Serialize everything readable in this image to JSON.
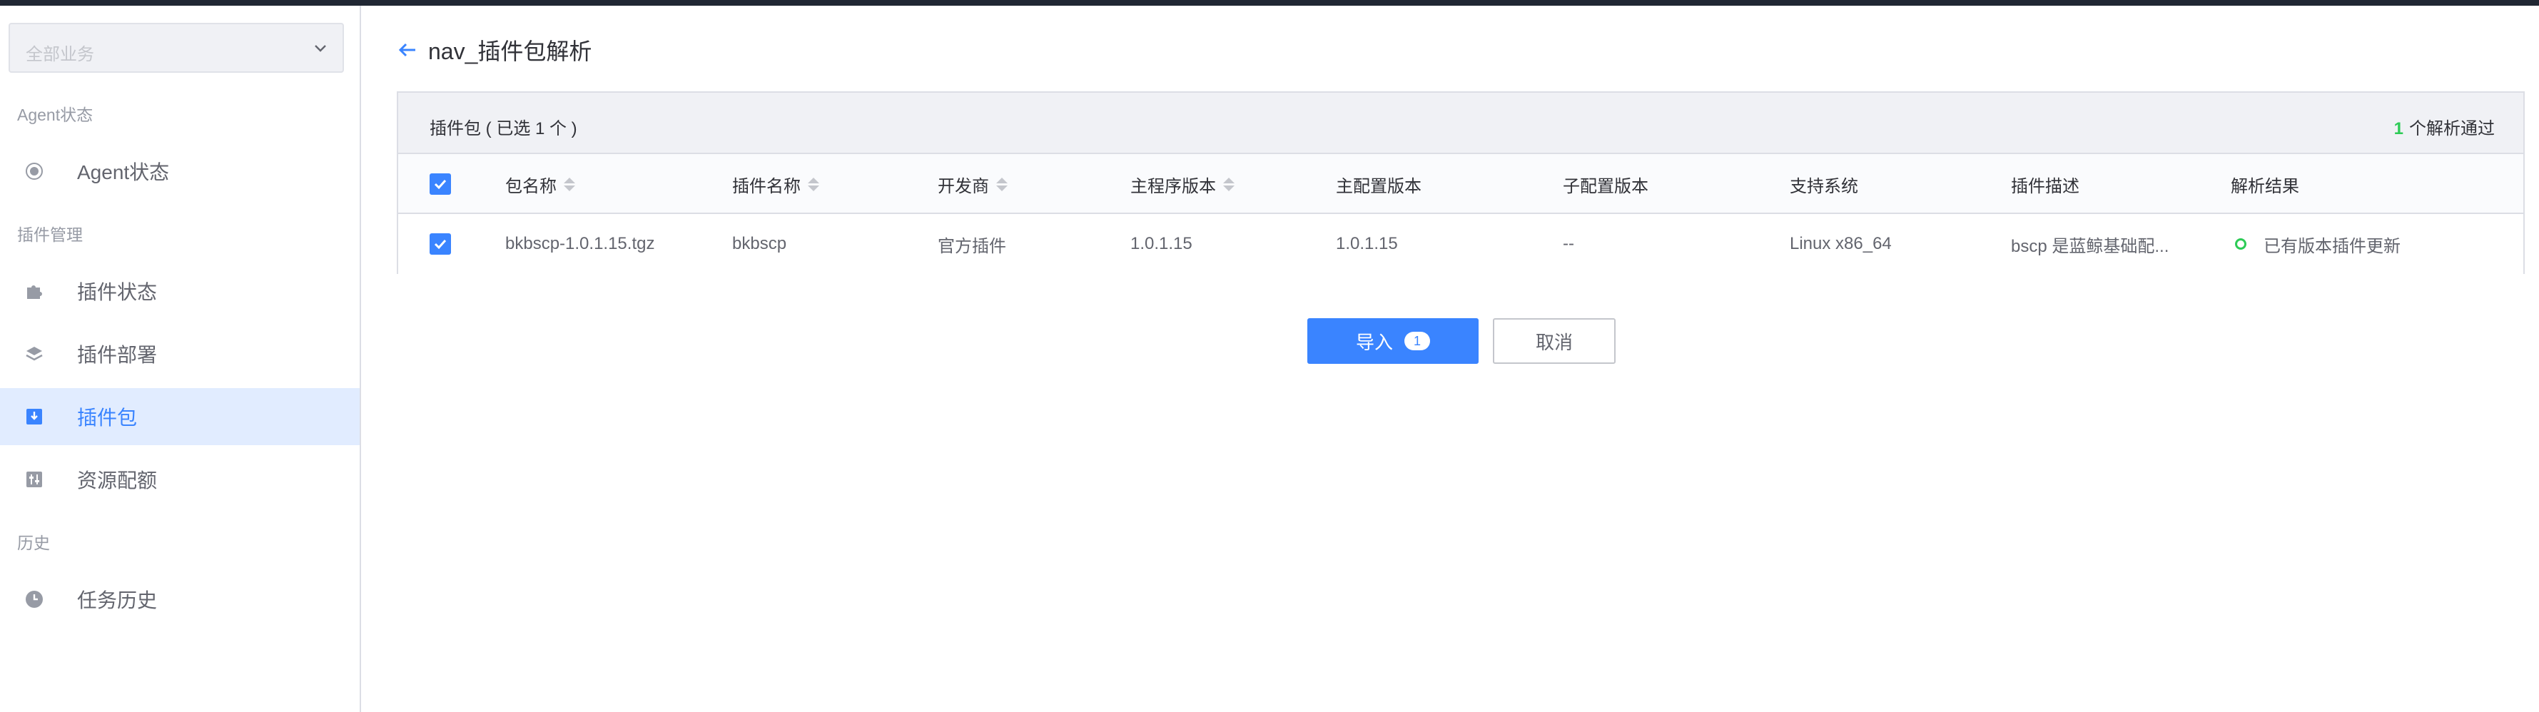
{
  "sidebar": {
    "business_select": {
      "placeholder": "全部业务"
    },
    "groups": [
      {
        "title": "Agent状态"
      },
      {
        "title": "插件管理"
      },
      {
        "title": "历史"
      }
    ],
    "items": [
      {
        "label": "Agent状态",
        "icon": "radio-dot-icon"
      },
      {
        "label": "插件状态",
        "icon": "puzzle-icon"
      },
      {
        "label": "插件部署",
        "icon": "layers-icon"
      },
      {
        "label": "插件包",
        "icon": "download-box-icon",
        "active": true
      },
      {
        "label": "资源配额",
        "icon": "sliders-icon"
      },
      {
        "label": "任务历史",
        "icon": "clock-icon"
      }
    ]
  },
  "page": {
    "title": "nav_插件包解析"
  },
  "table": {
    "selected_summary": "插件包 ( 已选 1 个 )",
    "pass_count": "1",
    "pass_text": "个解析通过",
    "columns": [
      "包名称",
      "插件名称",
      "开发商",
      "主程序版本",
      "主配置版本",
      "子配置版本",
      "支持系统",
      "插件描述",
      "解析结果"
    ],
    "rows": [
      {
        "package": "bkbscp-1.0.1.15.tgz",
        "plugin_name": "bkbscp",
        "developer": "官方插件",
        "main_version": "1.0.1.15",
        "main_config_version": "1.0.1.15",
        "sub_config_version": "--",
        "os": "Linux x86_64",
        "description": "bscp 是蓝鲸基础配...",
        "result": "已有版本插件更新"
      }
    ]
  },
  "actions": {
    "import_label": "导入",
    "import_count": "1",
    "cancel_label": "取消"
  },
  "colors": {
    "primary": "#3a84ff",
    "success": "#2dcb56",
    "topbar": "#202733"
  }
}
